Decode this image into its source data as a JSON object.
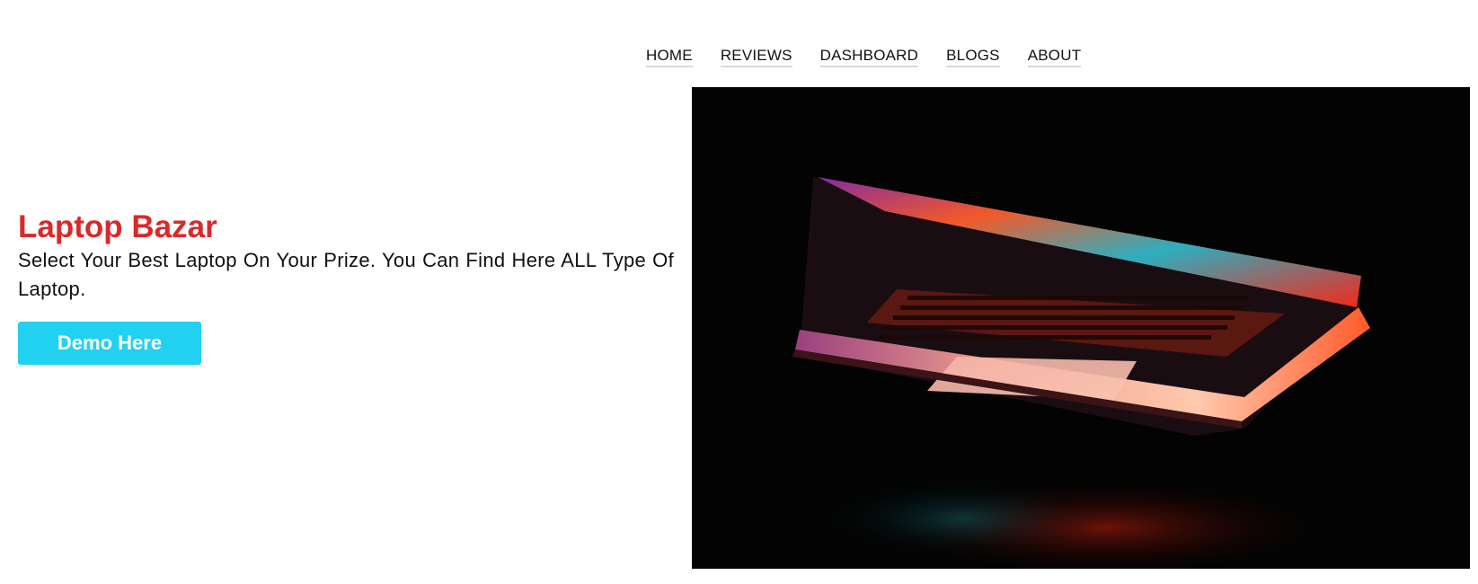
{
  "nav": {
    "items": [
      {
        "label": "HOME"
      },
      {
        "label": "REVIEWS"
      },
      {
        "label": "DASHBOARD"
      },
      {
        "label": "BLOGS"
      },
      {
        "label": "ABOUT"
      }
    ]
  },
  "hero": {
    "title": "Laptop Bazar",
    "description": "Select Your Best Laptop On Your Prize. You Can Find Here ALL Type Of Laptop.",
    "button_label": "Demo Here",
    "image_icon": "laptop-photo"
  },
  "colors": {
    "title": "#d82a2a",
    "button": "#22d0ef",
    "image_background": "#030303"
  }
}
